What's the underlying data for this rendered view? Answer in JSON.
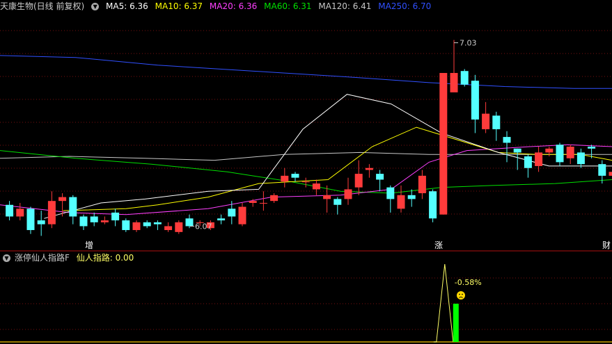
{
  "colors": {
    "up": "#ff3b3b",
    "down": "#54ffff",
    "ma5": "#ffffff",
    "ma10": "#ffff00",
    "ma20": "#ff40ff",
    "ma60": "#00e000",
    "ma120": "#c8c8c8",
    "ma250": "#3050ff",
    "grid": "#7a1010",
    "signal": "#00ff00",
    "signal_line": "#ffff66"
  },
  "legend": {
    "stock_title": "天康生物(日线 前复权)",
    "ma5": "MA5: 6.36",
    "ma10": "MA10: 6.37",
    "ma20": "MA20: 6.36",
    "ma60": "MA60: 6.31",
    "ma120": "MA120: 6.41",
    "ma250": "MA250: 6.70"
  },
  "indicator": {
    "name": "涨停仙人指路F",
    "value_label": "仙人指路: 0.00",
    "pct_label": "-0.58%",
    "face_icon": "sad-face-icon"
  },
  "markers": {
    "zeng": "增",
    "zhang": "涨",
    "cai": "财"
  },
  "chart_data": {
    "type": "candlestick",
    "annotations": {
      "high": "7.03",
      "low": "6.07"
    },
    "candles": [
      [
        6.18,
        6.12,
        6.2,
        6.1
      ],
      [
        6.12,
        6.16,
        6.19,
        6.1
      ],
      [
        6.16,
        6.05,
        6.17,
        6.03
      ],
      [
        6.1,
        6.08,
        6.15,
        6.02
      ],
      [
        6.08,
        6.2,
        6.25,
        6.06
      ],
      [
        6.2,
        6.22,
        6.24,
        6.12
      ],
      [
        6.22,
        6.12,
        6.23,
        6.08
      ],
      [
        6.12,
        6.07,
        6.13,
        6.05
      ],
      [
        6.12,
        6.09,
        6.14,
        6.07
      ],
      [
        6.09,
        6.1,
        6.12,
        6.08
      ],
      [
        6.14,
        6.1,
        6.16,
        6.07
      ],
      [
        6.1,
        6.05,
        6.11,
        6.04
      ],
      [
        6.05,
        6.09,
        6.1,
        6.04
      ],
      [
        6.09,
        6.07,
        6.1,
        6.06
      ],
      [
        6.09,
        6.08,
        6.1,
        6.05
      ],
      [
        6.05,
        6.07,
        6.09,
        6.04
      ],
      [
        6.04,
        6.09,
        6.1,
        6.03
      ],
      [
        6.11,
        6.07,
        6.13,
        6.06
      ],
      [
        6.09,
        6.09,
        6.1,
        6.07
      ],
      [
        6.06,
        6.09,
        6.1,
        6.05
      ],
      [
        6.11,
        6.1,
        6.13,
        6.08
      ],
      [
        6.16,
        6.12,
        6.2,
        6.08
      ],
      [
        6.08,
        6.17,
        6.19,
        6.07
      ],
      [
        6.19,
        6.2,
        6.21,
        6.17
      ],
      [
        6.19,
        6.19,
        6.25,
        6.15
      ],
      [
        6.2,
        6.23,
        6.24,
        6.19
      ],
      [
        6.3,
        6.33,
        6.37,
        6.27
      ],
      [
        6.34,
        6.32,
        6.35,
        6.3
      ],
      [
        6.3,
        6.3,
        6.32,
        6.27
      ],
      [
        6.26,
        6.29,
        6.31,
        6.23
      ],
      [
        6.21,
        6.23,
        6.28,
        6.14
      ],
      [
        6.21,
        6.18,
        6.22,
        6.13
      ],
      [
        6.21,
        6.26,
        6.32,
        6.18
      ],
      [
        6.27,
        6.34,
        6.41,
        6.23
      ],
      [
        6.36,
        6.37,
        6.39,
        6.32
      ],
      [
        6.34,
        6.31,
        6.36,
        6.25
      ],
      [
        6.27,
        6.21,
        6.28,
        6.14
      ],
      [
        6.16,
        6.23,
        6.28,
        6.14
      ],
      [
        6.23,
        6.21,
        6.26,
        6.17
      ],
      [
        6.24,
        6.33,
        6.36,
        6.21
      ],
      [
        6.25,
        6.11,
        6.26,
        6.09
      ],
      [
        6.13,
        6.86,
        6.86,
        6.13
      ],
      [
        6.76,
        6.86,
        7.03,
        6.84
      ],
      [
        6.87,
        6.8,
        6.88,
        6.79
      ],
      [
        6.82,
        6.62,
        6.85,
        6.55
      ],
      [
        6.57,
        6.65,
        6.71,
        6.55
      ],
      [
        6.64,
        6.57,
        6.66,
        6.51
      ],
      [
        6.53,
        6.5,
        6.56,
        6.4
      ],
      [
        6.47,
        6.45,
        6.47,
        6.36
      ],
      [
        6.43,
        6.37,
        6.44,
        6.32
      ],
      [
        6.38,
        6.45,
        6.48,
        6.35
      ],
      [
        6.45,
        6.47,
        6.48,
        6.43
      ],
      [
        6.49,
        6.4,
        6.5,
        6.38
      ],
      [
        6.42,
        6.48,
        6.49,
        6.39
      ],
      [
        6.45,
        6.39,
        6.47,
        6.37
      ],
      [
        6.48,
        6.47,
        6.49,
        6.42
      ],
      [
        6.39,
        6.33,
        6.41,
        6.29
      ],
      [
        6.33,
        6.35,
        6.4,
        6.32
      ],
      [
        6.39,
        6.35,
        6.41,
        6.3
      ]
    ],
    "ma": {
      "ma5": [
        [
          6.07,
          6.11
        ],
        [
          6.16,
          6.19
        ],
        [
          6.23,
          6.21
        ],
        [
          6.33,
          6.25
        ],
        [
          6.41,
          6.26
        ],
        [
          6.48,
          6.57
        ],
        [
          6.55,
          6.75
        ],
        [
          6.62,
          6.7
        ],
        [
          6.7,
          6.55
        ],
        [
          6.79,
          6.45
        ],
        [
          6.87,
          6.38
        ],
        [
          6.93,
          6.38
        ],
        [
          6.97,
          6.38
        ]
      ],
      "ma10": [
        [
          6.1,
          6.15
        ],
        [
          6.2,
          6.16
        ],
        [
          6.25,
          6.18
        ],
        [
          6.33,
          6.22
        ],
        [
          6.41,
          6.29
        ],
        [
          6.52,
          6.31
        ],
        [
          6.59,
          6.48
        ],
        [
          6.66,
          6.58
        ],
        [
          6.72,
          6.52
        ],
        [
          6.79,
          6.45
        ],
        [
          6.85,
          6.44
        ],
        [
          6.92,
          6.44
        ],
        [
          6.97,
          6.41
        ]
      ],
      "ma20": [
        [
          6.0,
          6.18
        ],
        [
          6.11,
          6.14
        ],
        [
          6.2,
          6.13
        ],
        [
          6.33,
          6.16
        ],
        [
          6.43,
          6.22
        ],
        [
          6.54,
          6.23
        ],
        [
          6.62,
          6.26
        ],
        [
          6.68,
          6.4
        ],
        [
          6.74,
          6.46
        ],
        [
          6.84,
          6.48
        ],
        [
          6.9,
          6.49
        ],
        [
          6.97,
          6.48
        ]
      ],
      "ma60": [
        [
          6.0,
          6.46
        ],
        [
          6.12,
          6.42
        ],
        [
          6.24,
          6.39
        ],
        [
          6.36,
          6.35
        ],
        [
          6.46,
          6.3
        ],
        [
          6.54,
          6.25
        ],
        [
          6.62,
          6.24
        ],
        [
          6.7,
          6.27
        ],
        [
          6.78,
          6.28
        ],
        [
          6.88,
          6.29
        ],
        [
          6.97,
          6.31
        ]
      ],
      "ma120": [
        [
          6.0,
          6.42
        ],
        [
          6.11,
          6.43
        ],
        [
          6.23,
          6.42
        ],
        [
          6.34,
          6.41
        ],
        [
          6.45,
          6.44
        ],
        [
          6.57,
          6.45
        ],
        [
          6.68,
          6.44
        ],
        [
          6.8,
          6.44
        ],
        [
          6.91,
          6.44
        ],
        [
          6.97,
          6.44
        ]
      ],
      "ma250": [
        [
          6.0,
          6.95
        ],
        [
          6.12,
          6.94
        ],
        [
          6.25,
          6.9
        ],
        [
          6.4,
          6.87
        ],
        [
          6.55,
          6.84
        ],
        [
          6.68,
          6.81
        ],
        [
          6.8,
          6.79
        ],
        [
          6.91,
          6.78
        ],
        [
          6.97,
          6.78
        ]
      ]
    },
    "indicator_series": [
      0,
      0,
      0,
      0,
      0,
      0,
      0,
      0,
      0,
      0,
      0,
      0,
      0,
      0,
      0,
      0,
      0,
      0,
      0,
      0,
      0,
      0,
      0,
      0,
      0,
      0,
      0,
      0,
      0,
      0,
      0,
      0,
      0,
      0,
      0,
      0,
      0,
      0,
      0,
      0,
      0,
      1,
      0,
      0,
      0,
      0,
      0,
      0,
      0,
      0,
      0,
      0,
      0,
      0,
      0,
      0,
      0,
      0,
      0
    ]
  }
}
